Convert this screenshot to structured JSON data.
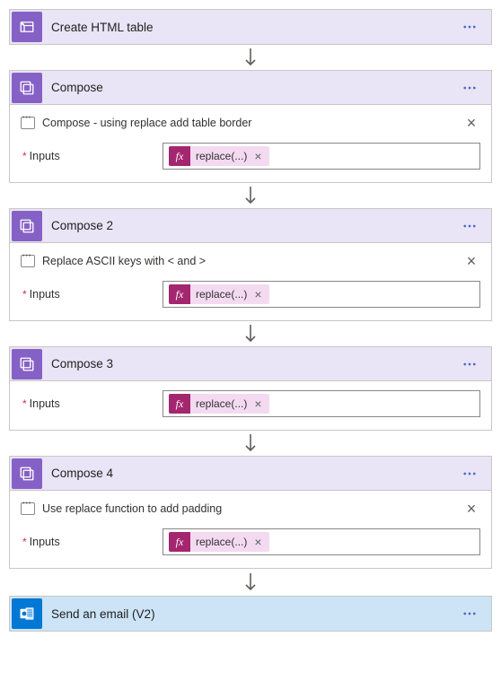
{
  "steps": [
    {
      "title": "Create HTML table",
      "iconType": "table",
      "headerStyle": "purple noborder",
      "note": null,
      "showInputs": false,
      "expr": null
    },
    {
      "title": "Compose",
      "iconType": "compose",
      "headerStyle": "purple",
      "note": "Compose - using replace add table border",
      "showInputs": true,
      "expr": "replace(...)"
    },
    {
      "title": "Compose 2",
      "iconType": "compose",
      "headerStyle": "purple",
      "note": "Replace ASCII keys with < and >",
      "showInputs": true,
      "expr": "replace(...)"
    },
    {
      "title": "Compose 3",
      "iconType": "compose",
      "headerStyle": "purple",
      "note": null,
      "showInputs": true,
      "expr": "replace(...)"
    },
    {
      "title": "Compose 4",
      "iconType": "compose",
      "headerStyle": "purple",
      "note": "Use replace function to add padding",
      "showInputs": true,
      "expr": "replace(...)"
    },
    {
      "title": "Send an email (V2)",
      "iconType": "outlook",
      "headerStyle": "blue",
      "note": null,
      "showInputs": false,
      "expr": null
    }
  ],
  "labels": {
    "inputs": "Inputs",
    "fx": "fx"
  },
  "colors": {
    "purpleAccent": "#8661c5",
    "blueAccent": "#0078d4",
    "tokenBg": "#f3daf1",
    "tokenAccent": "#a4266e"
  }
}
